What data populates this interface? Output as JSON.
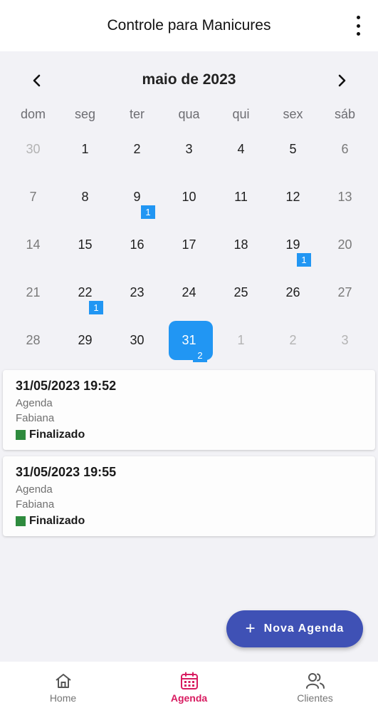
{
  "app": {
    "title": "Controle para Manicures"
  },
  "calendar": {
    "month_label": "maio de 2023",
    "weekdays": [
      "dom",
      "seg",
      "ter",
      "qua",
      "qui",
      "sex",
      "sáb"
    ],
    "weeks": [
      [
        {
          "n": "30",
          "out": true
        },
        {
          "n": "1"
        },
        {
          "n": "2"
        },
        {
          "n": "3"
        },
        {
          "n": "4"
        },
        {
          "n": "5"
        },
        {
          "n": "6"
        }
      ],
      [
        {
          "n": "7"
        },
        {
          "n": "8"
        },
        {
          "n": "9",
          "badge": "1"
        },
        {
          "n": "10"
        },
        {
          "n": "11"
        },
        {
          "n": "12"
        },
        {
          "n": "13"
        }
      ],
      [
        {
          "n": "14"
        },
        {
          "n": "15"
        },
        {
          "n": "16"
        },
        {
          "n": "17"
        },
        {
          "n": "18"
        },
        {
          "n": "19",
          "badge": "1"
        },
        {
          "n": "20"
        }
      ],
      [
        {
          "n": "21"
        },
        {
          "n": "22",
          "badge": "1"
        },
        {
          "n": "23"
        },
        {
          "n": "24"
        },
        {
          "n": "25"
        },
        {
          "n": "26"
        },
        {
          "n": "27"
        }
      ],
      [
        {
          "n": "28"
        },
        {
          "n": "29"
        },
        {
          "n": "30"
        },
        {
          "n": "31",
          "badge": "2",
          "selected": true
        },
        {
          "n": "1",
          "out": true
        },
        {
          "n": "2",
          "out": true
        },
        {
          "n": "3",
          "out": true
        }
      ]
    ]
  },
  "appointments": [
    {
      "datetime": "31/05/2023 19:52",
      "type": "Agenda",
      "client": "Fabiana",
      "status": "Finalizado"
    },
    {
      "datetime": "31/05/2023 19:55",
      "type": "Agenda",
      "client": "Fabiana",
      "status": "Finalizado"
    }
  ],
  "fab": {
    "icon": "plus-icon",
    "label": "Nova Agenda"
  },
  "bottom_nav": [
    {
      "icon": "home-icon",
      "label": "Home",
      "active": false
    },
    {
      "icon": "calendar-icon",
      "label": "Agenda",
      "active": true
    },
    {
      "icon": "people-icon",
      "label": "Clientes",
      "active": false
    }
  ],
  "colors": {
    "selected_day": "#2196f3",
    "badge": "#2196f3",
    "status_finalizado": "#2e8b3e",
    "fab": "#3f51b5",
    "nav_active": "#d81b60"
  }
}
